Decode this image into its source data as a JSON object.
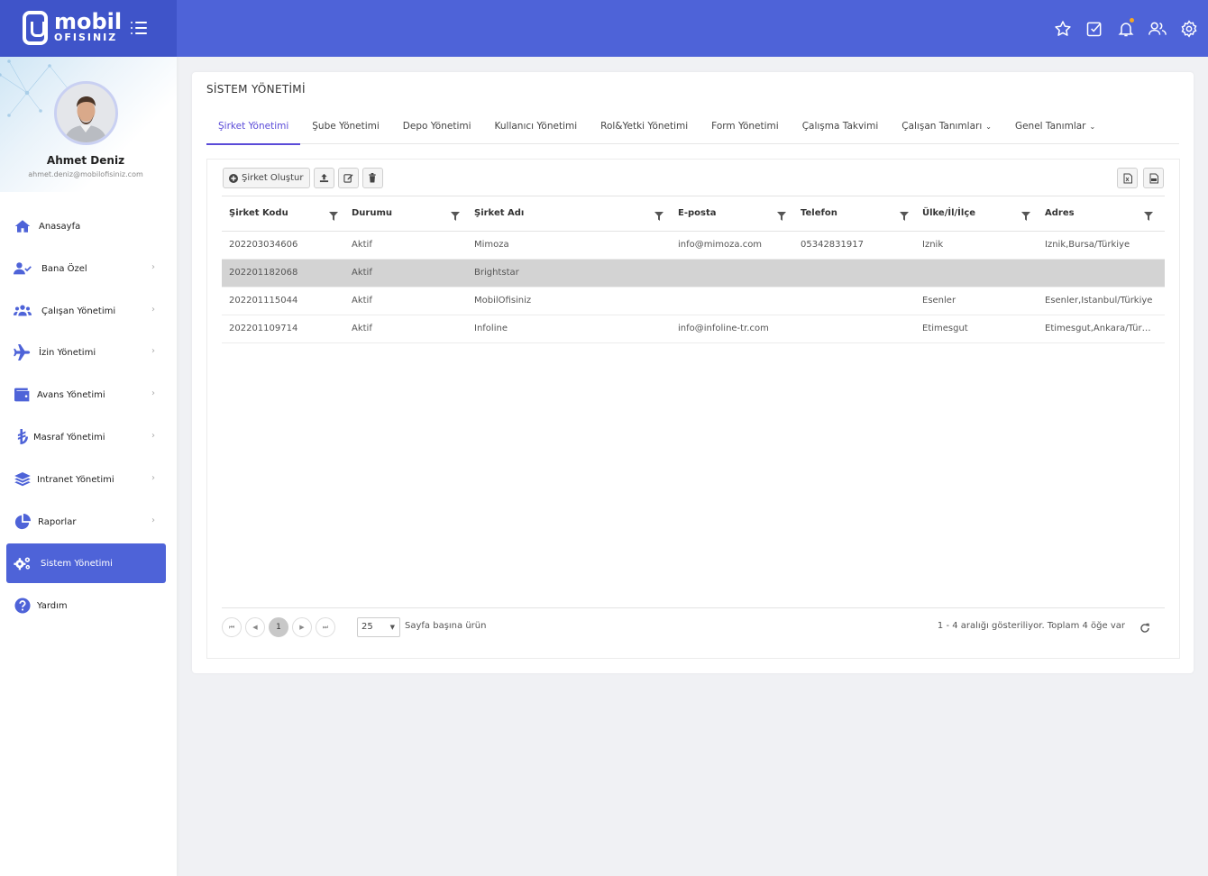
{
  "brand": {
    "name_top": "mobil",
    "name_bottom": "OFISINIZ"
  },
  "header_icons": [
    "star-icon",
    "checklist-icon",
    "bell-icon",
    "users-icon",
    "gear-icon"
  ],
  "profile": {
    "name": "Ahmet Deniz",
    "email": "ahmet.deniz@mobilofisiniz.com"
  },
  "sidebar": {
    "items": [
      {
        "label": "Anasayfa",
        "icon": "home-icon",
        "chevron": false,
        "active": false
      },
      {
        "label": "Bana Özel",
        "icon": "user-check-icon",
        "chevron": true,
        "active": false
      },
      {
        "label": "Çalışan Yönetimi",
        "icon": "users-icon",
        "chevron": true,
        "active": false
      },
      {
        "label": "İzin Yönetimi",
        "icon": "plane-icon",
        "chevron": true,
        "active": false
      },
      {
        "label": "Avans Yönetimi",
        "icon": "wallet-icon",
        "chevron": true,
        "active": false
      },
      {
        "label": "Masraf Yönetimi",
        "icon": "lira-icon",
        "chevron": true,
        "active": false
      },
      {
        "label": "Intranet Yönetimi",
        "icon": "layers-icon",
        "chevron": true,
        "active": false
      },
      {
        "label": "Raporlar",
        "icon": "pie-chart-icon",
        "chevron": true,
        "active": false
      },
      {
        "label": "Sistem Yönetimi",
        "icon": "gears-icon",
        "chevron": false,
        "active": true
      },
      {
        "label": "Yardım",
        "icon": "question-icon",
        "chevron": false,
        "active": false
      }
    ]
  },
  "main": {
    "title": "SİSTEM YÖNETİMİ",
    "tabs": [
      {
        "label": "Şirket Yönetimi",
        "active": true,
        "dropdown": false
      },
      {
        "label": "Şube Yönetimi",
        "active": false,
        "dropdown": false
      },
      {
        "label": "Depo Yönetimi",
        "active": false,
        "dropdown": false
      },
      {
        "label": "Kullanıcı Yönetimi",
        "active": false,
        "dropdown": false
      },
      {
        "label": "Rol&Yetki Yönetimi",
        "active": false,
        "dropdown": false
      },
      {
        "label": "Form Yönetimi",
        "active": false,
        "dropdown": false
      },
      {
        "label": "Çalışma Takvimi",
        "active": false,
        "dropdown": false
      },
      {
        "label": "Çalışan Tanımları",
        "active": false,
        "dropdown": true
      },
      {
        "label": "Genel Tanımlar",
        "active": false,
        "dropdown": true
      }
    ],
    "toolbar": {
      "create_label": "Şirket Oluştur",
      "buttons": [
        "upload-icon",
        "edit-icon",
        "trash-icon"
      ],
      "right_buttons": [
        "excel-export-icon",
        "pdf-export-icon"
      ]
    },
    "table": {
      "columns": [
        "Şirket Kodu",
        "Durumu",
        "Şirket Adı",
        "E-posta",
        "Telefon",
        "Ülke/İl/İlçe",
        "Adres"
      ],
      "rows": [
        [
          "202203034606",
          "Aktif",
          "Mimoza",
          "info@mimoza.com",
          "05342831917",
          "İznik",
          "İznik,Bursa/Türkiye"
        ],
        [
          "202201182068",
          "Aktif",
          "Brightstar",
          "",
          "",
          "",
          ""
        ],
        [
          "202201115044",
          "Aktif",
          "MobilOfisiniz",
          "",
          "",
          "Esenler",
          "Esenler,İstanbul/Türkiye"
        ],
        [
          "202201109714",
          "Aktif",
          "Infoline",
          "info@infoline-tr.com",
          "",
          "Etimesgut",
          "Etimesgut,Ankara/Türkiye"
        ]
      ],
      "selected_row": 1
    },
    "pager": {
      "current_page": "1",
      "page_size": "25",
      "page_size_label": "Sayfa başına ürün",
      "info": "1 - 4 aralığı gösteriliyor. Toplam 4 öğe var"
    }
  },
  "colors": {
    "header": "#4e63d8",
    "brand_bg": "#3f54c9",
    "active_tab": "#5a4bd8",
    "selected_row": "#d3d3d3"
  }
}
